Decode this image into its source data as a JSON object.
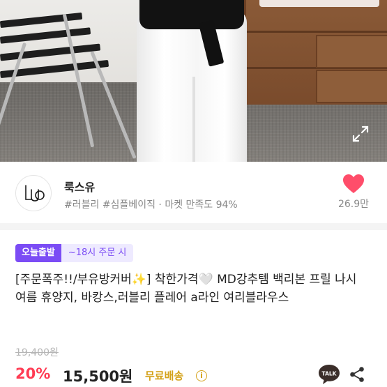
{
  "seller": {
    "name": "룩스유",
    "tags": "#러블리 #심플베이직",
    "separator": " · ",
    "satisfaction": "마켓 만족도 94%",
    "like_count": "26.9만"
  },
  "badges": {
    "today": "오늘출발",
    "cutoff": "~18시 주문 시"
  },
  "product": {
    "title": "[주문폭주!!/부유방커버✨] 착한가격🤍 MD강추템 백리본 프릴 나시 여름 휴양지, 바캉스,러블리 플레어 a라인 여리블라우스",
    "original_price": "19,400원",
    "discount": "20%",
    "price": "15,500원",
    "shipping": "무료배송"
  },
  "icons": {
    "expand": "expand-icon",
    "like": "heart-icon",
    "info": "info-icon",
    "talk": "kakaotalk-icon",
    "share": "share-icon"
  },
  "colors": {
    "accent": "#7b4cf5",
    "discount": "#ff3b53",
    "heart": "#ff4d6a",
    "shipping": "#d4a21a"
  }
}
